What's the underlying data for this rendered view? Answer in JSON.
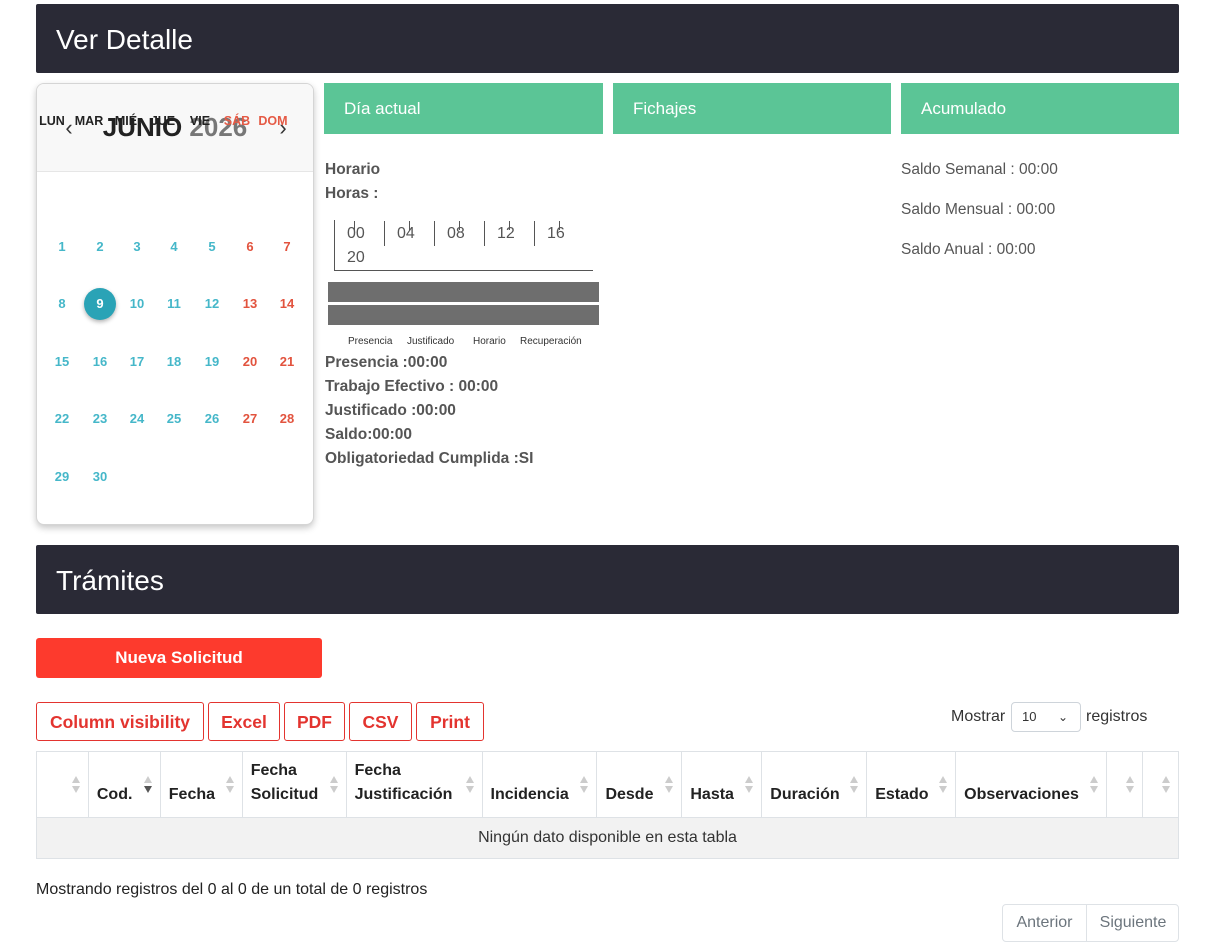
{
  "header": {
    "title": "Ver Detalle"
  },
  "calendar": {
    "month": "JUNIO",
    "year": "2026",
    "prev_icon": "chevron-left-icon",
    "next_icon": "chevron-right-icon",
    "prev_glyph": "‹",
    "next_glyph": "›",
    "weekdays": [
      "LUN",
      "MAR",
      "MIÉ",
      "JUE",
      "VIE",
      "SÁB",
      "DOM"
    ],
    "weeks": [
      [
        "1",
        "2",
        "3",
        "4",
        "5",
        "6",
        "7"
      ],
      [
        "8",
        "9",
        "10",
        "11",
        "12",
        "13",
        "14"
      ],
      [
        "15",
        "16",
        "17",
        "18",
        "19",
        "20",
        "21"
      ],
      [
        "22",
        "23",
        "24",
        "25",
        "26",
        "27",
        "28"
      ],
      [
        "29",
        "30",
        "",
        "",
        "",
        "",
        ""
      ]
    ],
    "selected_day": "9"
  },
  "panels": {
    "current_day": "Día actual",
    "clockings": "Fichajes",
    "accumulated": "Acumulado"
  },
  "day_info": {
    "schedule_label": "Horario",
    "hours_label": "Horas :",
    "timeline_ticks": [
      "00",
      "04",
      "08",
      "12",
      "16",
      "20"
    ],
    "legend": [
      "Presencia",
      "Justificado",
      "Horario",
      "Recuperación"
    ],
    "presence": "Presencia :00:00",
    "effective_work": "Trabajo Efectivo : 00:00",
    "justified": "Justificado :00:00",
    "balance": "Saldo:00:00",
    "obligation": "Obligatoriedad Cumplida :SI"
  },
  "accumulated": {
    "weekly": "Saldo Semanal : 00:00",
    "monthly": "Saldo Mensual : 00:00",
    "yearly": "Saldo Anual : 00:00"
  },
  "tramites": {
    "title": "Trámites",
    "new_request": "Nueva Solicitud",
    "export_buttons": [
      "Column visibility",
      "Excel",
      "PDF",
      "CSV",
      "Print"
    ],
    "show_label": "Mostrar",
    "page_size": "10",
    "records_label": "registros",
    "columns": [
      {
        "line1": "",
        "line2": ""
      },
      {
        "line1": "",
        "line2": "Cod."
      },
      {
        "line1": "",
        "line2": "Fecha"
      },
      {
        "line1": "Fecha",
        "line2": "Solicitud"
      },
      {
        "line1": "Fecha",
        "line2": "Justificación"
      },
      {
        "line1": "",
        "line2": "Incidencia"
      },
      {
        "line1": "",
        "line2": "Desde"
      },
      {
        "line1": "",
        "line2": "Hasta"
      },
      {
        "line1": "",
        "line2": "Duración"
      },
      {
        "line1": "",
        "line2": "Estado"
      },
      {
        "line1": "",
        "line2": "Observaciones"
      },
      {
        "line1": "",
        "line2": ""
      },
      {
        "line1": "",
        "line2": ""
      }
    ],
    "empty_message": "Ningún dato disponible en esta tabla",
    "info": "Mostrando registros del 0 al 0 de un total de 0 registros",
    "prev": "Anterior",
    "next": "Siguiente"
  },
  "colors": {
    "header_bg": "#2a2a36",
    "panel_green": "#5bc596",
    "accent_red": "#fd3a2d",
    "day_teal": "#45b7c9",
    "weekend_red": "#e2533e"
  }
}
